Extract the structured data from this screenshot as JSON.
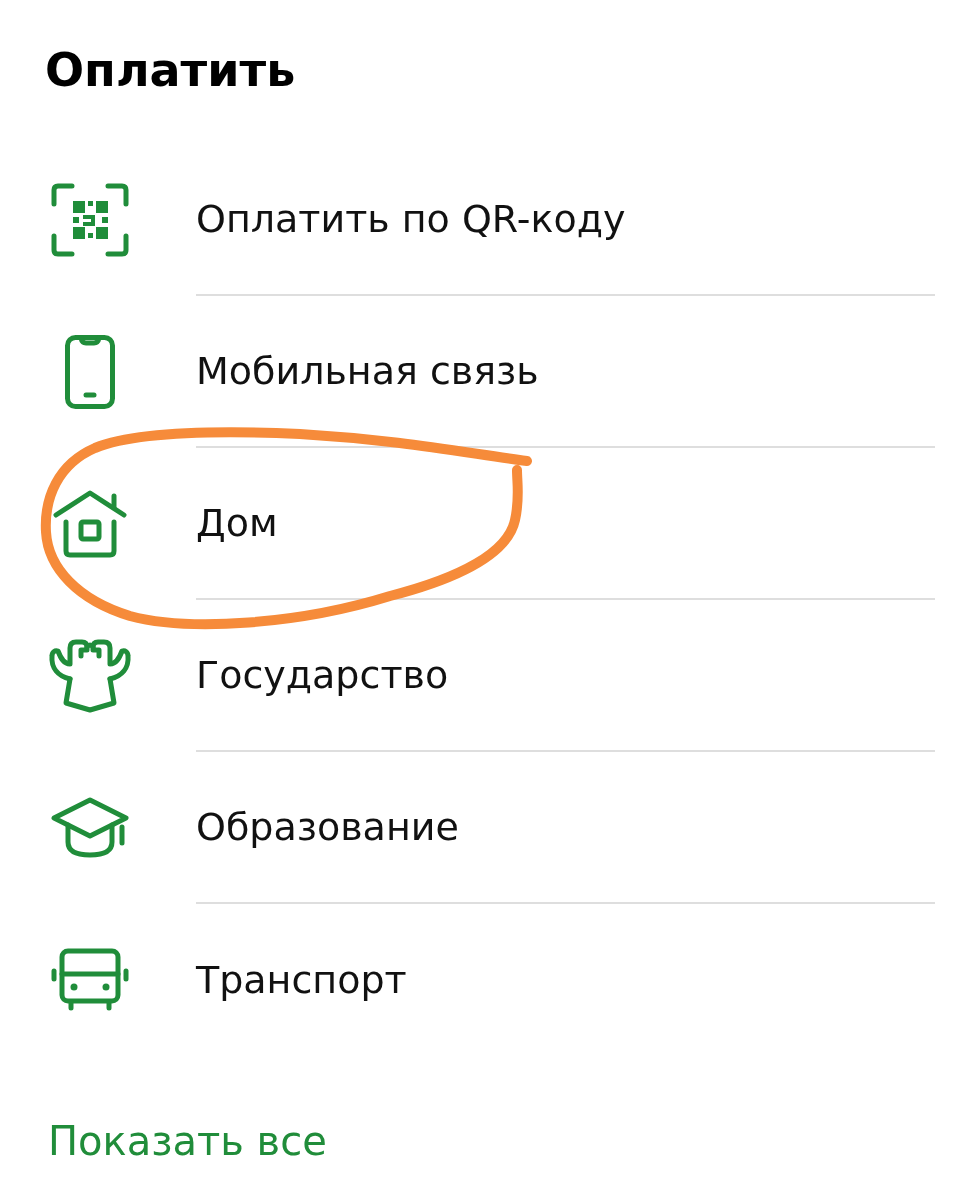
{
  "title": "Оплатить",
  "items": [
    {
      "kind": "qr",
      "label": "Оплатить по QR-коду",
      "highlighted": false
    },
    {
      "kind": "phone",
      "label": "Мобильная связь",
      "highlighted": false
    },
    {
      "kind": "house",
      "label": "Дом",
      "highlighted": true
    },
    {
      "kind": "emblem",
      "label": "Государство",
      "highlighted": false
    },
    {
      "kind": "cap",
      "label": "Образование",
      "highlighted": false
    },
    {
      "kind": "bus",
      "label": "Транспорт",
      "highlighted": false
    }
  ],
  "show_all": {
    "label": "Показать все"
  }
}
